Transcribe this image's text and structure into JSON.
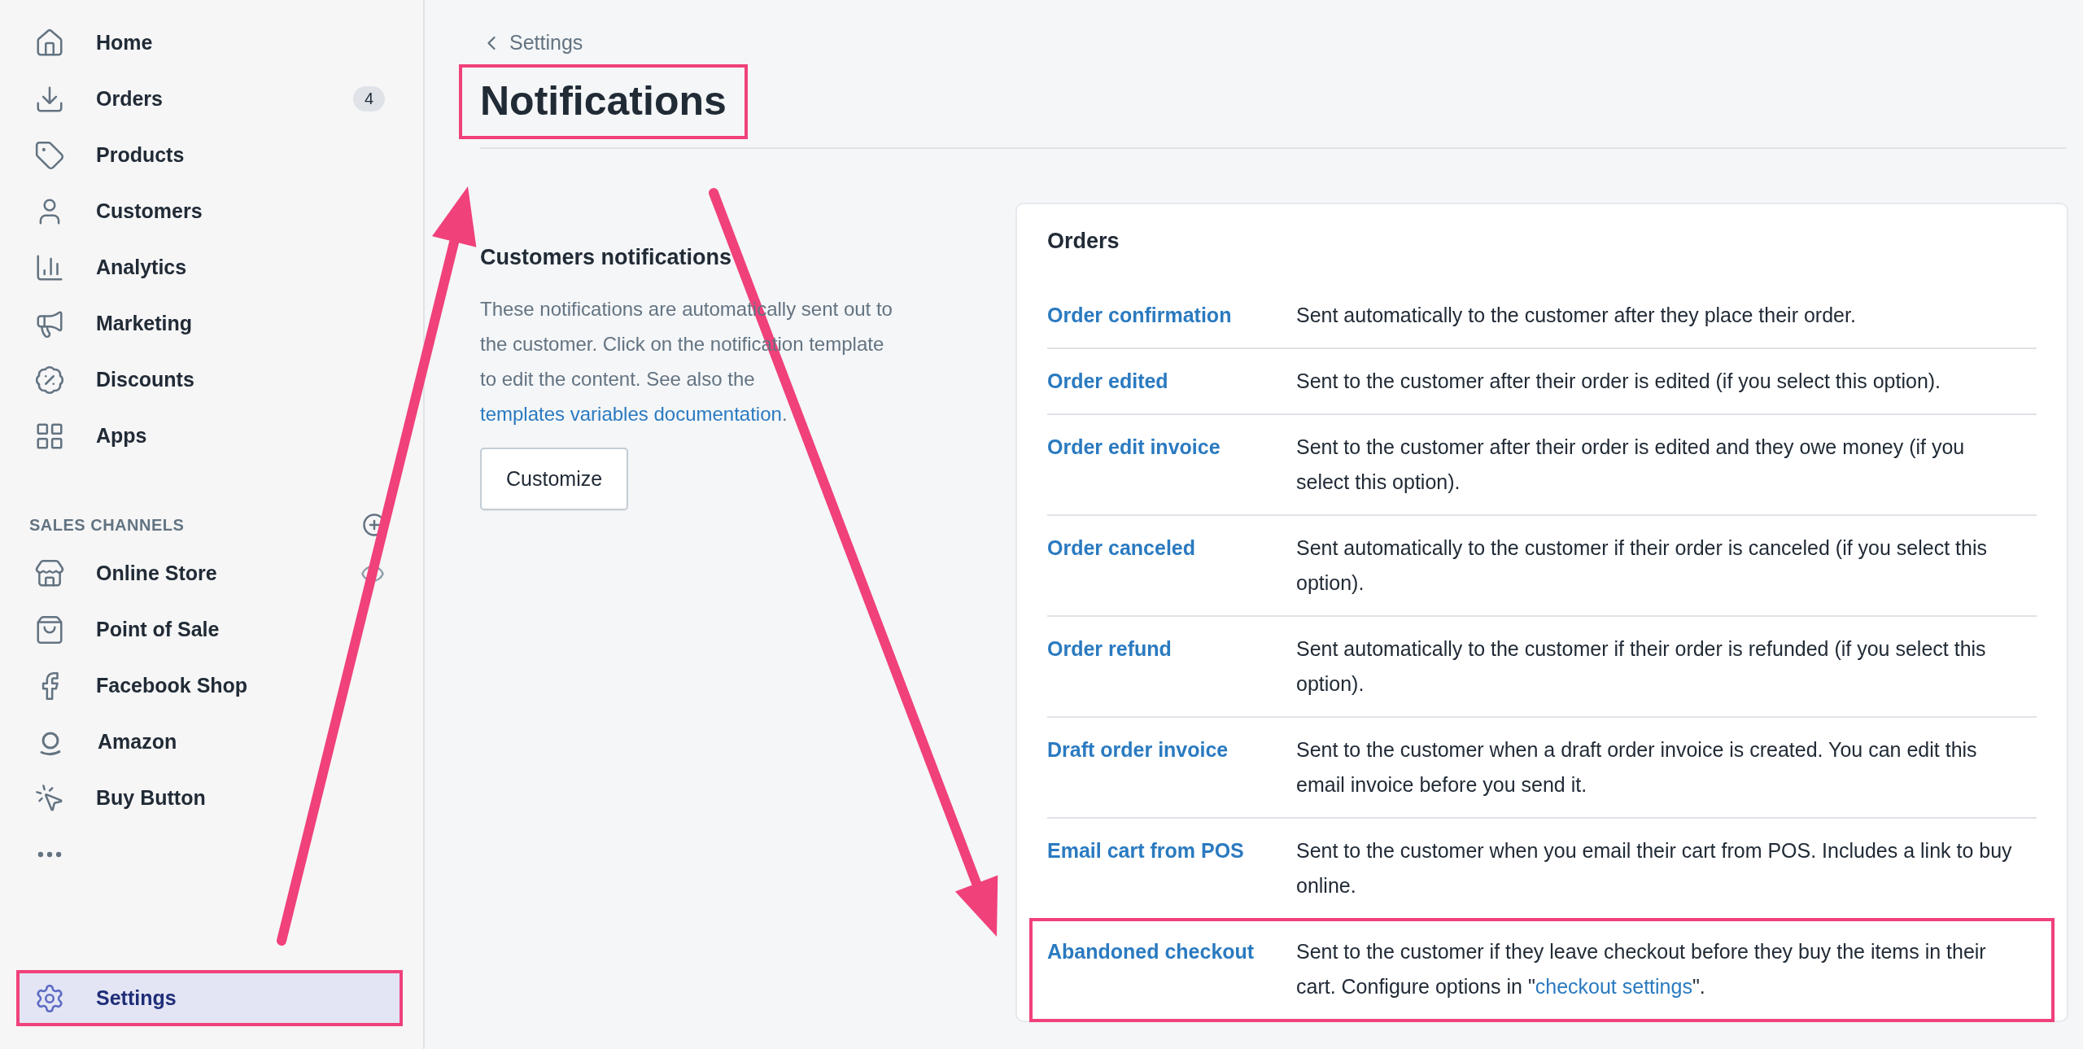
{
  "sidebar": {
    "items": [
      {
        "label": "Home",
        "selected": false,
        "highlighted": false
      },
      {
        "label": "Orders",
        "badge": "4",
        "selected": false,
        "highlighted": false
      },
      {
        "label": "Products",
        "selected": false,
        "highlighted": false
      },
      {
        "label": "Customers",
        "selected": false,
        "highlighted": false
      },
      {
        "label": "Analytics",
        "selected": false,
        "highlighted": false
      },
      {
        "label": "Marketing",
        "selected": false,
        "highlighted": false
      },
      {
        "label": "Discounts",
        "selected": false,
        "highlighted": false
      },
      {
        "label": "Apps",
        "selected": false,
        "highlighted": false
      }
    ],
    "sales_channels": {
      "heading": "SALES CHANNELS",
      "items": [
        {
          "label": "Online Store"
        },
        {
          "label": "Point of Sale"
        },
        {
          "label": "Facebook Shop"
        },
        {
          "label": "Amazon"
        },
        {
          "label": "Buy Button"
        }
      ]
    },
    "settings": {
      "label": "Settings",
      "selected": true,
      "highlighted": true
    }
  },
  "breadcrumb": "Settings",
  "title": {
    "text": "Notifications",
    "highlighted": true
  },
  "intro": {
    "heading": "Customers notifications",
    "text": "These notifications are automatically sent out to the customer. Click on the notification template to edit the content. See also the ",
    "link": "templates variables documentation",
    "text_after": ".",
    "button": "Customize"
  },
  "card": {
    "title": "Orders",
    "rows": [
      {
        "name": "Order confirmation",
        "desc": "Sent automatically to the customer after they place their order.",
        "highlighted": false
      },
      {
        "name": "Order edited",
        "desc": "Sent to the customer after their order is edited (if you select this option).",
        "highlighted": false
      },
      {
        "name": "Order edit invoice",
        "desc": "Sent to the customer after their order is edited and they owe money (if you select this option).",
        "highlighted": false
      },
      {
        "name": "Order canceled",
        "desc": "Sent automatically to the customer if their order is canceled (if you select this option).",
        "highlighted": false
      },
      {
        "name": "Order refund",
        "desc": "Sent automatically to the customer if their order is refunded (if you select this option).",
        "highlighted": false
      },
      {
        "name": "Draft order invoice",
        "desc": "Sent to the customer when a draft order invoice is created. You can edit this email invoice before you send it.",
        "highlighted": false
      },
      {
        "name": "Email cart from POS",
        "desc": "Sent to the customer when you email their cart from POS. Includes a link to buy online.",
        "highlighted": false
      },
      {
        "name": "Abandoned checkout",
        "desc": "Sent to the customer if they leave checkout before they buy the items in their cart. Configure options in \"",
        "link": "checkout settings",
        "desc_after": "\".",
        "highlighted": true
      }
    ]
  }
}
